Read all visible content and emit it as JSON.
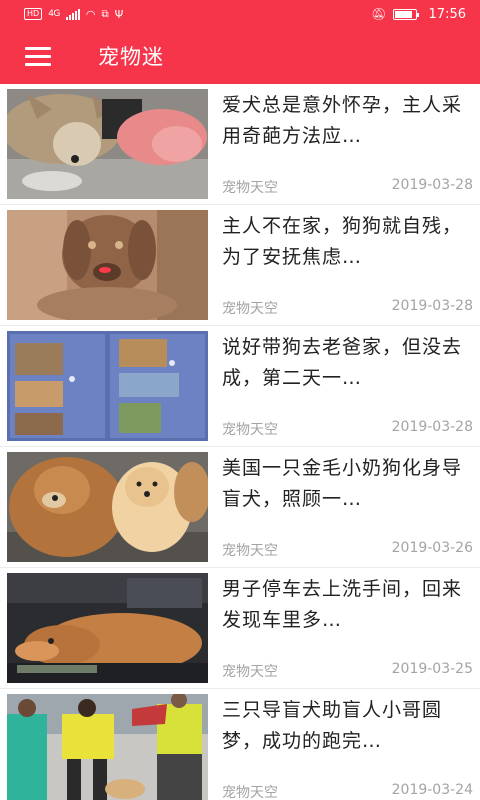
{
  "status_bar": {
    "left_icons": [
      "hd-icon",
      "4g-signal-icon",
      "signal-icon",
      "wifi-icon",
      "link-icon",
      "usb-icon"
    ],
    "hd_label": "HD",
    "net_label": "4G",
    "battery_level": 0.85,
    "time": "17:56"
  },
  "app_bar": {
    "title": "宠物迷",
    "menu_icon": "hamburger-menu-icon"
  },
  "articles": [
    {
      "title": "爱犬总是意外怀孕，主人采用奇葩方法应…",
      "source": "宠物天空",
      "date": "2019-03-28",
      "thumb": "dog-with-pink-sleeve"
    },
    {
      "title": "主人不在家，狗狗就自残，为了安抚焦虑…",
      "source": "宠物天空",
      "date": "2019-03-28",
      "thumb": "brown-dog-closeup"
    },
    {
      "title": "说好带狗去老爸家，但没去成，第二天一…",
      "source": "宠物天空",
      "date": "2019-03-28",
      "thumb": "chat-screenshots"
    },
    {
      "title": "美国一只金毛小奶狗化身导盲犬，照顾一…",
      "source": "宠物天空",
      "date": "2019-03-26",
      "thumb": "golden-retriever-and-puppy"
    },
    {
      "title": "男子停车去上洗手间，回来发现车里多…",
      "source": "宠物天空",
      "date": "2019-03-25",
      "thumb": "dog-in-car"
    },
    {
      "title": "三只导盲犬助盲人小哥圆梦，成功的跑完…",
      "source": "宠物天空",
      "date": "2019-03-24",
      "thumb": "marathon-with-guide-dog"
    }
  ],
  "colors": {
    "brand_red": "#f6344a",
    "title_text": "#222222",
    "meta_text": "#a4a4a4",
    "divider": "#ececec"
  }
}
